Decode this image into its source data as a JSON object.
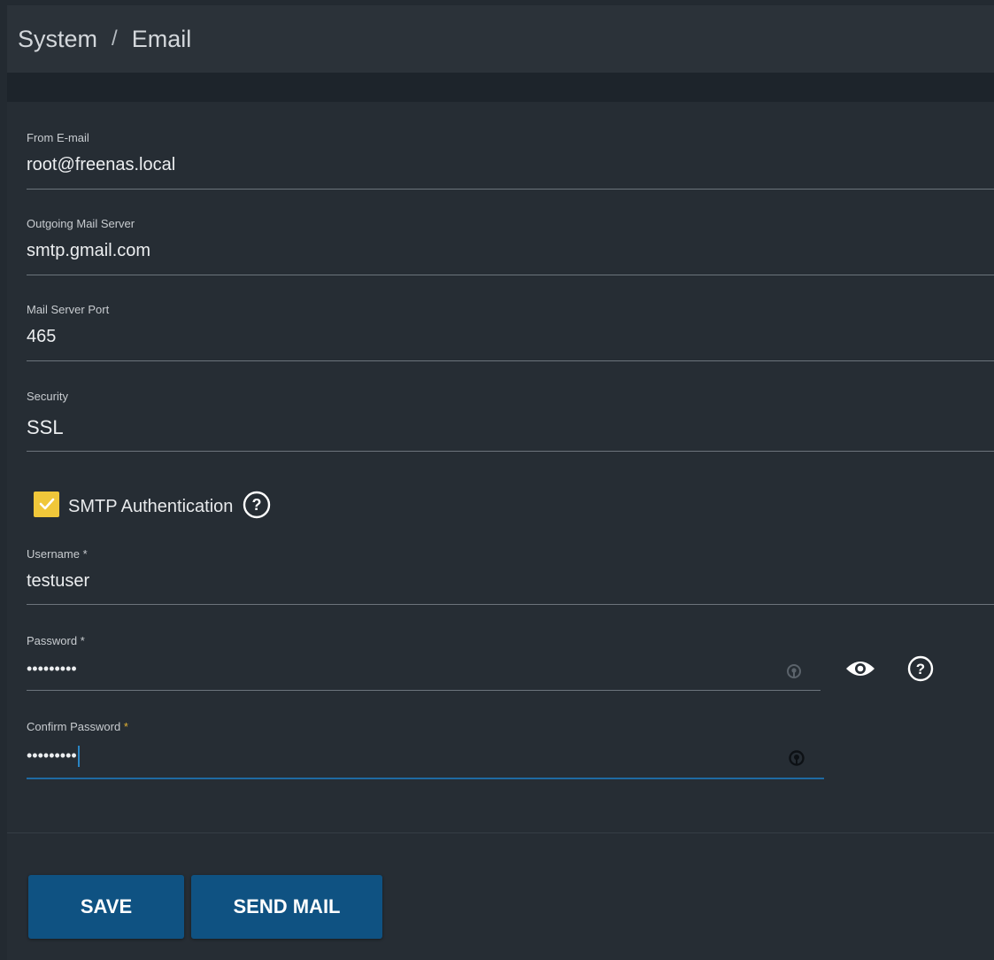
{
  "header": {
    "breadcrumb": [
      "System",
      "Email"
    ],
    "separator": "/"
  },
  "form": {
    "from_email": {
      "label": "From E-mail",
      "value": "root@freenas.local"
    },
    "outgoing_server": {
      "label": "Outgoing Mail Server",
      "value": "smtp.gmail.com"
    },
    "port": {
      "label": "Mail Server Port",
      "value": "465"
    },
    "security": {
      "label": "Security",
      "value": "SSL"
    },
    "smtp_auth": {
      "label": "SMTP Authentication",
      "checked": true
    },
    "username": {
      "label": "Username",
      "required": "*",
      "value": "testuser"
    },
    "password": {
      "label": "Password",
      "required": "*",
      "value": "•••••••••"
    },
    "confirm_password": {
      "label": "Confirm Password",
      "required": "*",
      "value": "•••••••••"
    }
  },
  "buttons": {
    "save": "SAVE",
    "send_mail": "SEND MAIL"
  },
  "colors": {
    "accent": "#0f5282",
    "checkbox": "#f0c73a",
    "focus_line": "#2a85c4",
    "required_star_focused": "#e0b034"
  },
  "icons": [
    "help-icon",
    "show-password-icon",
    "password-generator-icon",
    "check-icon"
  ]
}
